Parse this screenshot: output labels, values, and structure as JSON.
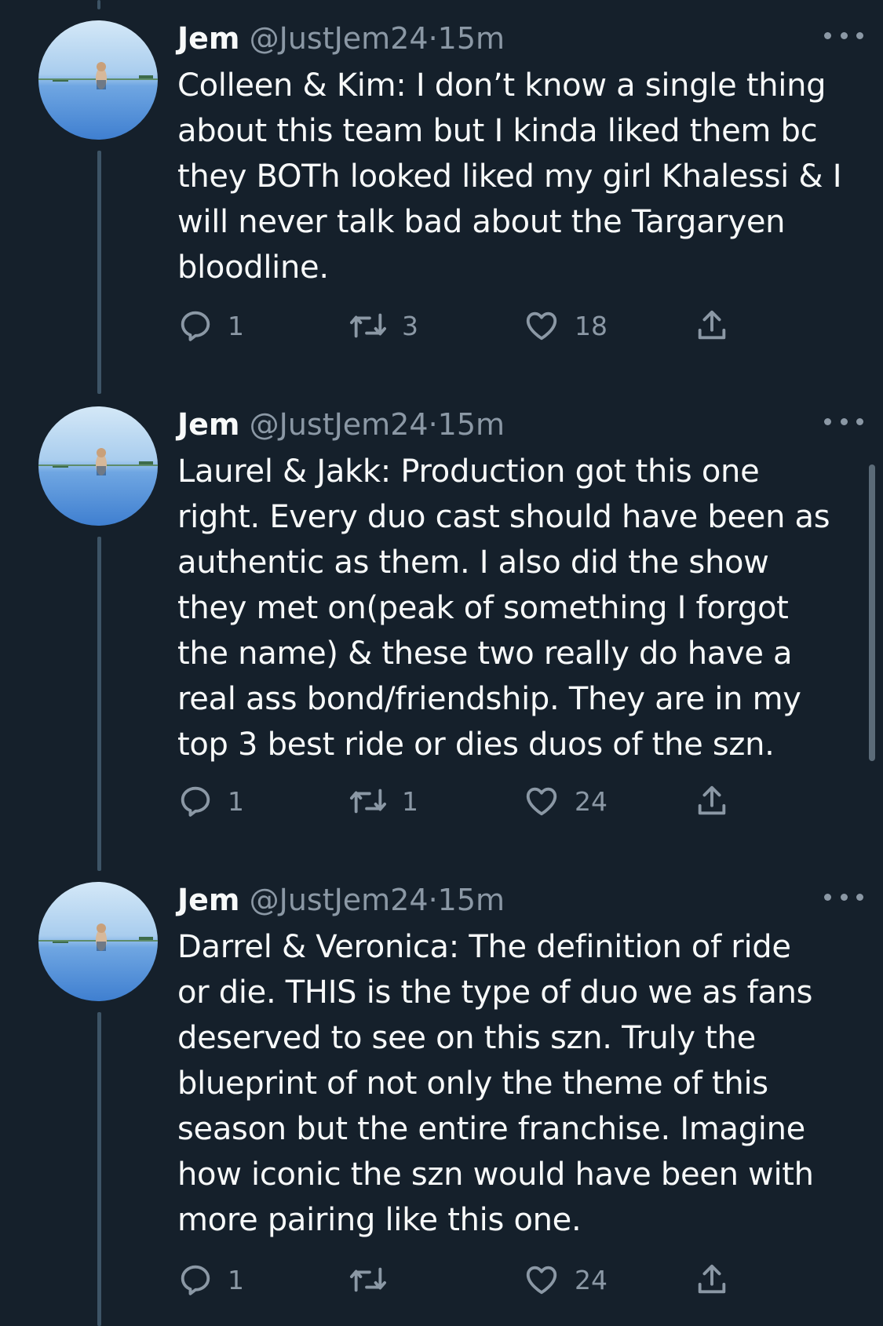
{
  "tweets": [
    {
      "author": {
        "name": "Jem",
        "handle": "@JustJem24",
        "separator": "·",
        "time": "15m",
        "avatar_icon": "avatar-beach-photo-icon"
      },
      "text": "Colleen & Kim: I don’t know a single thing\nabout this team but I kinda liked them bc\nthey BOTh looked liked my girl Khalessi & I\nwill never talk bad about the Targaryen\nbloodline.",
      "counts": {
        "replies": "1",
        "retweets": "3",
        "likes": "18"
      }
    },
    {
      "author": {
        "name": "Jem",
        "handle": "@JustJem24",
        "separator": "·",
        "time": "15m",
        "avatar_icon": "avatar-beach-photo-icon"
      },
      "text": "Laurel & Jakk: Production got this one\nright. Every duo cast should have been as\nauthentic as them. I also did the show\nthey met on(peak of something I forgot\nthe name) & these two really do have a\nreal ass bond/friendship. They are in my\ntop 3 best ride or dies duos of the szn.",
      "counts": {
        "replies": "1",
        "retweets": "1",
        "likes": "24"
      }
    },
    {
      "author": {
        "name": "Jem",
        "handle": "@JustJem24",
        "separator": "·",
        "time": "15m",
        "avatar_icon": "avatar-beach-photo-icon"
      },
      "text": "Darrel & Veronica: The definition of  ride\nor die. THIS is the type of duo we as fans\ndeserved to see on this szn. Truly the\nblueprint of not only the theme of this\nseason but the entire franchise. Imagine\nhow iconic the szn would have been with\nmore pairing like this one.",
      "counts": {
        "replies": "1",
        "retweets": "",
        "likes": "24"
      }
    }
  ],
  "icons": {
    "reply": "reply-icon",
    "retweet": "retweet-icon",
    "like": "heart-icon",
    "share": "share-icon",
    "more": "more-options-icon"
  },
  "colors": {
    "background": "#15202b",
    "primary_text": "#f7f9f9",
    "secondary_text": "#8b98a5",
    "thread_line": "#3d5466"
  }
}
